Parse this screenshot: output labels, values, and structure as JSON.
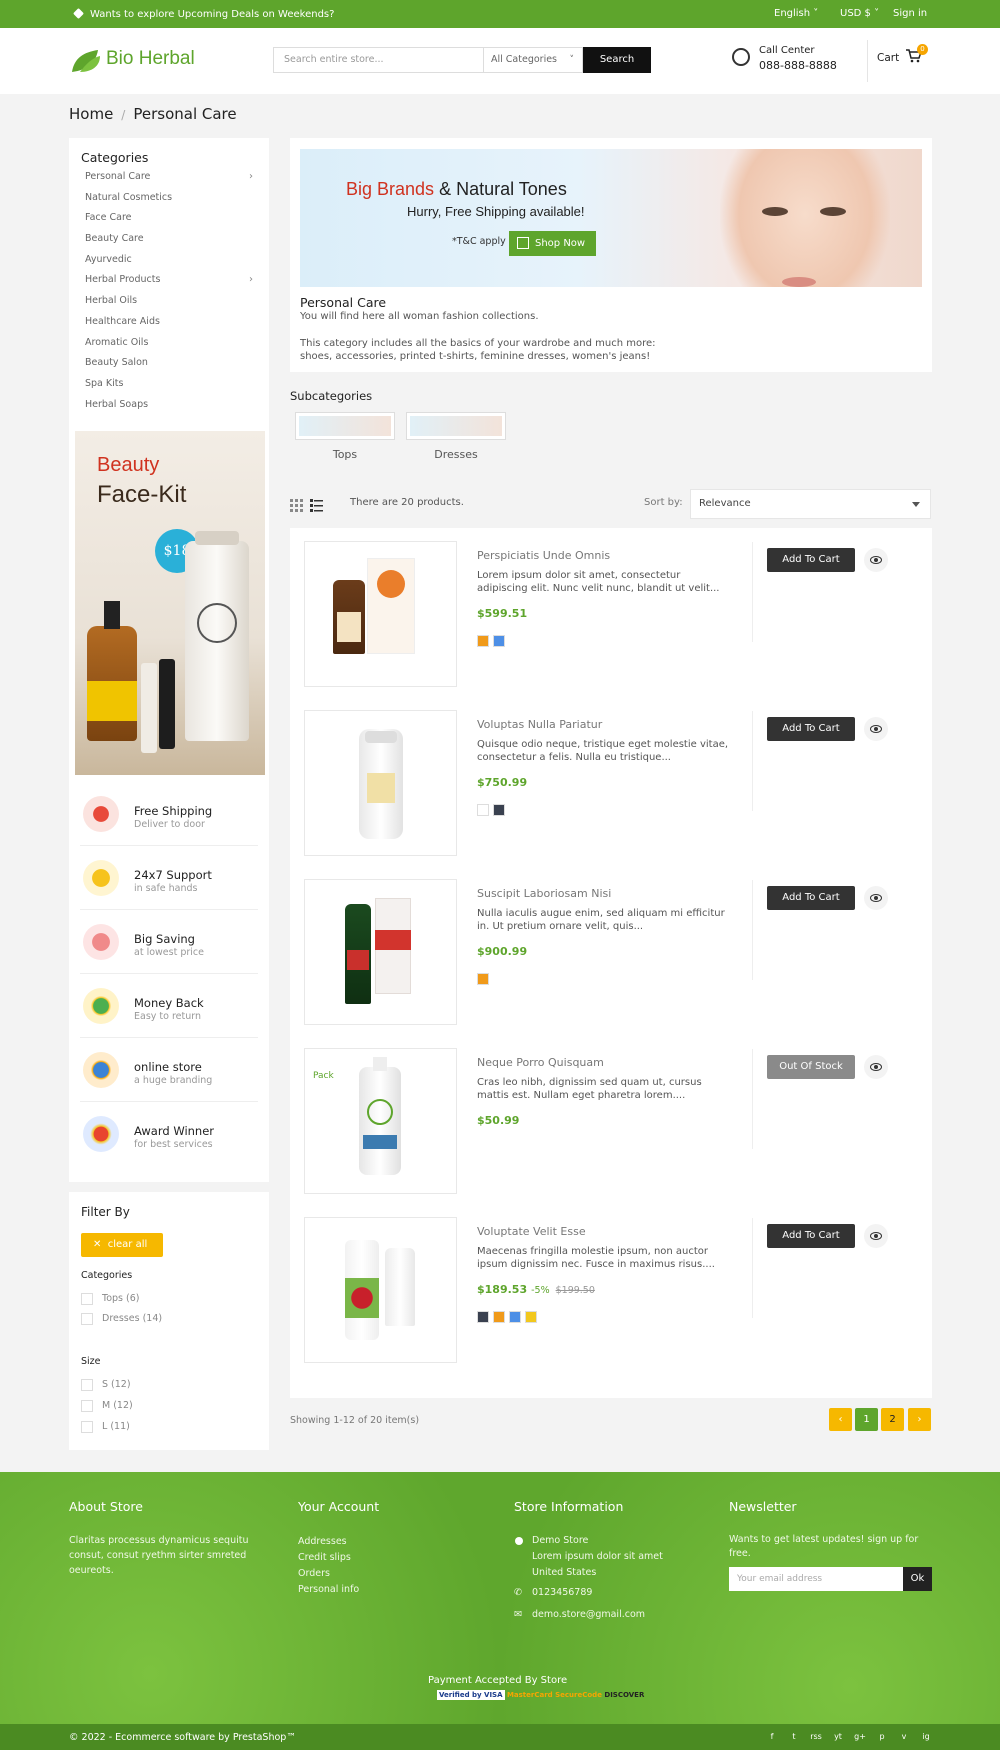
{
  "topbar": {
    "promo": "Wants to explore Upcoming Deals on Weekends?",
    "language": "English",
    "currency": "USD $",
    "signin": "Sign in"
  },
  "header": {
    "logo": "Bio Herbal",
    "search_placeholder": "Search entire store...",
    "category_select": "All Categories",
    "search_button": "Search",
    "call_label": "Call Center",
    "call_number": "088-888-8888",
    "cart_label": "Cart",
    "cart_count": "0"
  },
  "breadcrumb": {
    "home": "Home",
    "current": "Personal Care"
  },
  "sidebar": {
    "categories_title": "Categories",
    "categories": [
      "Personal Care",
      "Natural Cosmetics",
      "Face Care",
      "Beauty Care",
      "Ayurvedic",
      "Herbal Products",
      "Herbal Oils",
      "Healthcare Aids",
      "Aromatic Oils",
      "Beauty Salon",
      "Spa Kits",
      "Herbal Soaps"
    ],
    "promo": {
      "line1": "Beauty",
      "line2": "Face-Kit",
      "price": "$18"
    },
    "features": [
      {
        "title": "Free Shipping",
        "sub": "Deliver to door"
      },
      {
        "title": "24x7 Support",
        "sub": "in safe hands"
      },
      {
        "title": "Big Saving",
        "sub": "at lowest price"
      },
      {
        "title": "Money Back",
        "sub": "Easy to return"
      },
      {
        "title": "online store",
        "sub": "a huge branding"
      },
      {
        "title": "Award Winner",
        "sub": "for best services"
      }
    ],
    "filter": {
      "title": "Filter By",
      "clear": "clear all",
      "categories_title": "Categories",
      "categories": [
        "Tops (6)",
        "Dresses (14)"
      ],
      "size_title": "Size",
      "sizes": [
        "S (12)",
        "M (12)",
        "L (11)"
      ]
    }
  },
  "banner": {
    "title_red": "Big Brands",
    "title_rest": "& Natural Tones",
    "subtitle": "Hurry, Free Shipping available!",
    "tc": "*T&C apply",
    "button": "Shop Now"
  },
  "category": {
    "title": "Personal Care",
    "desc1": "You will find here all woman fashion collections.",
    "desc2": "This category includes all the basics of your wardrobe and much more:",
    "desc3": "shoes, accessories, printed t-shirts, feminine dresses, women's jeans!"
  },
  "subcategories": {
    "title": "Subcategories",
    "items": [
      "Tops",
      "Dresses"
    ]
  },
  "toolbar": {
    "count": "There are 20 products.",
    "sort_label": "Sort by:",
    "sort_value": "Relevance"
  },
  "products": [
    {
      "name": "Perspiciatis Unde Omnis",
      "desc1": "Lorem ipsum dolor sit amet, consectetur",
      "desc2": "adipiscing elit. Nunc velit nunc, blandit ut velit...",
      "price": "$599.51",
      "button": "Add To Cart",
      "colors": [
        "#f09a1a",
        "#4d8fe6"
      ]
    },
    {
      "name": "Voluptas Nulla Pariatur",
      "desc1": "Quisque odio neque, tristique eget molestie vitae,",
      "desc2": "consectetur a felis. Nulla eu tristique...",
      "price": "$750.99",
      "button": "Add To Cart",
      "colors": [
        "#ffffff",
        "#3a4150"
      ]
    },
    {
      "name": "Suscipit Laboriosam Nisi",
      "desc1": "Nulla iaculis augue enim, sed aliquam mi efficitur",
      "desc2": "in. Ut pretium ornare velit, quis...",
      "price": "$900.99",
      "button": "Add To Cart",
      "colors": [
        "#f09a1a"
      ]
    },
    {
      "name": "Neque Porro Quisquam",
      "desc1": "Cras leo nibh, dignissim sed quam ut, cursus",
      "desc2": "mattis est. Nullam eget pharetra lorem....",
      "price": "$50.99",
      "button": "Out Of Stock",
      "tag": "Pack",
      "colors": []
    },
    {
      "name": "Voluptate Velit Esse",
      "desc1": "Maecenas fringilla molestie ipsum, non auctor",
      "desc2": "ipsum dignissim nec. Fusce in maximus risus....",
      "price": "$189.53",
      "discount": "-5%",
      "old_price": "$199.50",
      "button": "Add To Cart",
      "colors": [
        "#3a4150",
        "#f09a1a",
        "#4d8fe6",
        "#f2c81e"
      ]
    }
  ],
  "pagination": {
    "showing": "Showing 1-12 of 20 item(s)",
    "prev": "‹",
    "pages": [
      "1",
      "2"
    ],
    "next": "›"
  },
  "footer": {
    "about_title": "About Store",
    "about_text": [
      "Claritas processus dynamicus sequitu",
      "consut, consut ryethm sirter smreted",
      "oeureots."
    ],
    "account_title": "Your Account",
    "account_links": [
      "Addresses",
      "Credit slips",
      "Orders",
      "Personal info"
    ],
    "store_title": "Store Information",
    "store_lines": [
      "Demo Store",
      "Lorem ipsum dolor sit amet",
      "United States"
    ],
    "phone": "0123456789",
    "email": "demo.store@gmail.com",
    "newsletter_title": "Newsletter",
    "newsletter_text": [
      "Wants to get latest updates! sign up for",
      "free."
    ],
    "email_placeholder": "Your email address",
    "ok": "Ok",
    "payment_title": "Payment Accepted By Store",
    "payments": [
      "Verified by VISA",
      "MasterCard SecureCode",
      "DISCOVER"
    ],
    "copyright": "© 2022 - Ecommerce software by PrestaShop™",
    "social": [
      "f",
      "t",
      "rss",
      "yt",
      "g+",
      "p",
      "v",
      "ig"
    ]
  },
  "colors": {
    "brand_green": "#5ea52c",
    "accent_yellow": "#f6b800",
    "dark": "#333333"
  }
}
